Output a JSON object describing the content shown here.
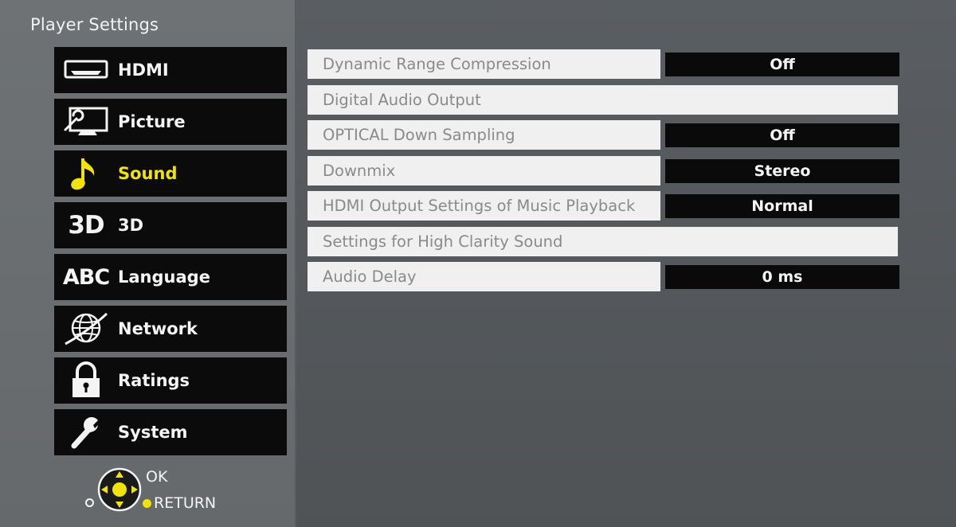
{
  "header": {
    "title": "Player Settings"
  },
  "menu": {
    "items": [
      {
        "label": "HDMI",
        "icon": "hdmi-icon"
      },
      {
        "label": "Picture",
        "icon": "picture-icon"
      },
      {
        "label": "Sound",
        "icon": "music-note-icon",
        "selected": true
      },
      {
        "label": "3D",
        "icon_text": "3D",
        "icon": "3d-icon"
      },
      {
        "label": "Language",
        "icon_text": "ABC",
        "icon": "language-icon"
      },
      {
        "label": "Network",
        "icon": "globe-icon"
      },
      {
        "label": "Ratings",
        "icon": "lock-icon"
      },
      {
        "label": "System",
        "icon": "wrench-icon"
      }
    ]
  },
  "nav_hint": {
    "ok": "OK",
    "return": "RETURN"
  },
  "settings": {
    "rows": [
      {
        "name": "Dynamic Range Compression",
        "value": "Off"
      },
      {
        "name": "Digital Audio Output"
      },
      {
        "name": "OPTICAL Down Sampling",
        "value": "Off"
      },
      {
        "name": "Downmix",
        "value": "Stereo"
      },
      {
        "name": "HDMI Output Settings of Music Playback",
        "value": "Normal"
      },
      {
        "name": "Settings for High Clarity Sound"
      },
      {
        "name": "Audio Delay",
        "value": "0 ms"
      }
    ]
  },
  "colors": {
    "selected_text": "#f1e20a",
    "menu_bg": "#0b0b0c",
    "row_bg": "#f0f0f0",
    "row_text": "#8a8a8a",
    "value_bg": "#0a0a0a"
  }
}
